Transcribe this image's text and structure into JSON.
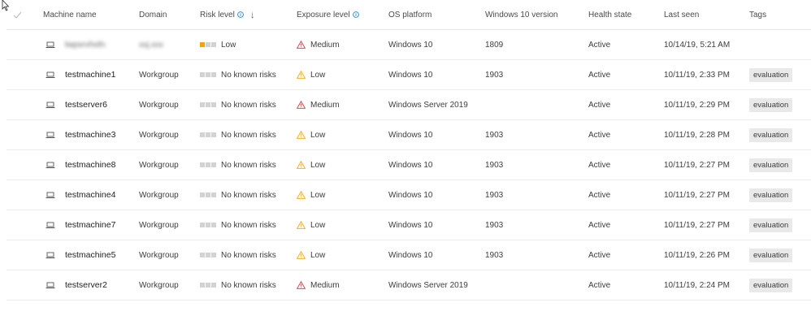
{
  "header": {
    "machine_name": "Machine name",
    "domain": "Domain",
    "risk_level": "Risk level",
    "exposure_level": "Exposure level",
    "os_platform": "OS platform",
    "windows_version": "Windows 10 version",
    "health_state": "Health state",
    "last_seen": "Last seen",
    "tags": "Tags",
    "sort_arrow": "↓"
  },
  "colors": {
    "risk_low": "#f0a30a",
    "risk_none": "#d2d2d2",
    "exposure_medium": "#d13438",
    "exposure_low": "#f0a30a",
    "tag_bg": "#e9e9e9"
  },
  "rows": [
    {
      "name": "lwpsrvhsfn",
      "domain": "xxj.xxx",
      "risk": "Low",
      "risk_bars": 1,
      "exposure": "Medium",
      "os": "Windows 10",
      "version": "1809",
      "health": "Active",
      "last_seen": "10/14/19, 5:21 AM",
      "tag": ""
    },
    {
      "name": "testmachine1",
      "domain": "Workgroup",
      "risk": "No known risks",
      "risk_bars": 0,
      "exposure": "Low",
      "os": "Windows 10",
      "version": "1903",
      "health": "Active",
      "last_seen": "10/11/19, 2:33 PM",
      "tag": "evaluation"
    },
    {
      "name": "testserver6",
      "domain": "Workgroup",
      "risk": "No known risks",
      "risk_bars": 0,
      "exposure": "Medium",
      "os": "Windows Server 2019",
      "version": "",
      "health": "Active",
      "last_seen": "10/11/19, 2:29 PM",
      "tag": "evaluation"
    },
    {
      "name": "testmachine3",
      "domain": "Workgroup",
      "risk": "No known risks",
      "risk_bars": 0,
      "exposure": "Low",
      "os": "Windows 10",
      "version": "1903",
      "health": "Active",
      "last_seen": "10/11/19, 2:28 PM",
      "tag": "evaluation"
    },
    {
      "name": "testmachine8",
      "domain": "Workgroup",
      "risk": "No known risks",
      "risk_bars": 0,
      "exposure": "Low",
      "os": "Windows 10",
      "version": "1903",
      "health": "Active",
      "last_seen": "10/11/19, 2:27 PM",
      "tag": "evaluation"
    },
    {
      "name": "testmachine4",
      "domain": "Workgroup",
      "risk": "No known risks",
      "risk_bars": 0,
      "exposure": "Low",
      "os": "Windows 10",
      "version": "1903",
      "health": "Active",
      "last_seen": "10/11/19, 2:27 PM",
      "tag": "evaluation"
    },
    {
      "name": "testmachine7",
      "domain": "Workgroup",
      "risk": "No known risks",
      "risk_bars": 0,
      "exposure": "Low",
      "os": "Windows 10",
      "version": "1903",
      "health": "Active",
      "last_seen": "10/11/19, 2:27 PM",
      "tag": "evaluation"
    },
    {
      "name": "testmachine5",
      "domain": "Workgroup",
      "risk": "No known risks",
      "risk_bars": 0,
      "exposure": "Low",
      "os": "Windows 10",
      "version": "1903",
      "health": "Active",
      "last_seen": "10/11/19, 2:26 PM",
      "tag": "evaluation"
    },
    {
      "name": "testserver2",
      "domain": "Workgroup",
      "risk": "No known risks",
      "risk_bars": 0,
      "exposure": "Medium",
      "os": "Windows Server 2019",
      "version": "",
      "health": "Active",
      "last_seen": "10/11/19, 2:24 PM",
      "tag": "evaluation"
    }
  ]
}
